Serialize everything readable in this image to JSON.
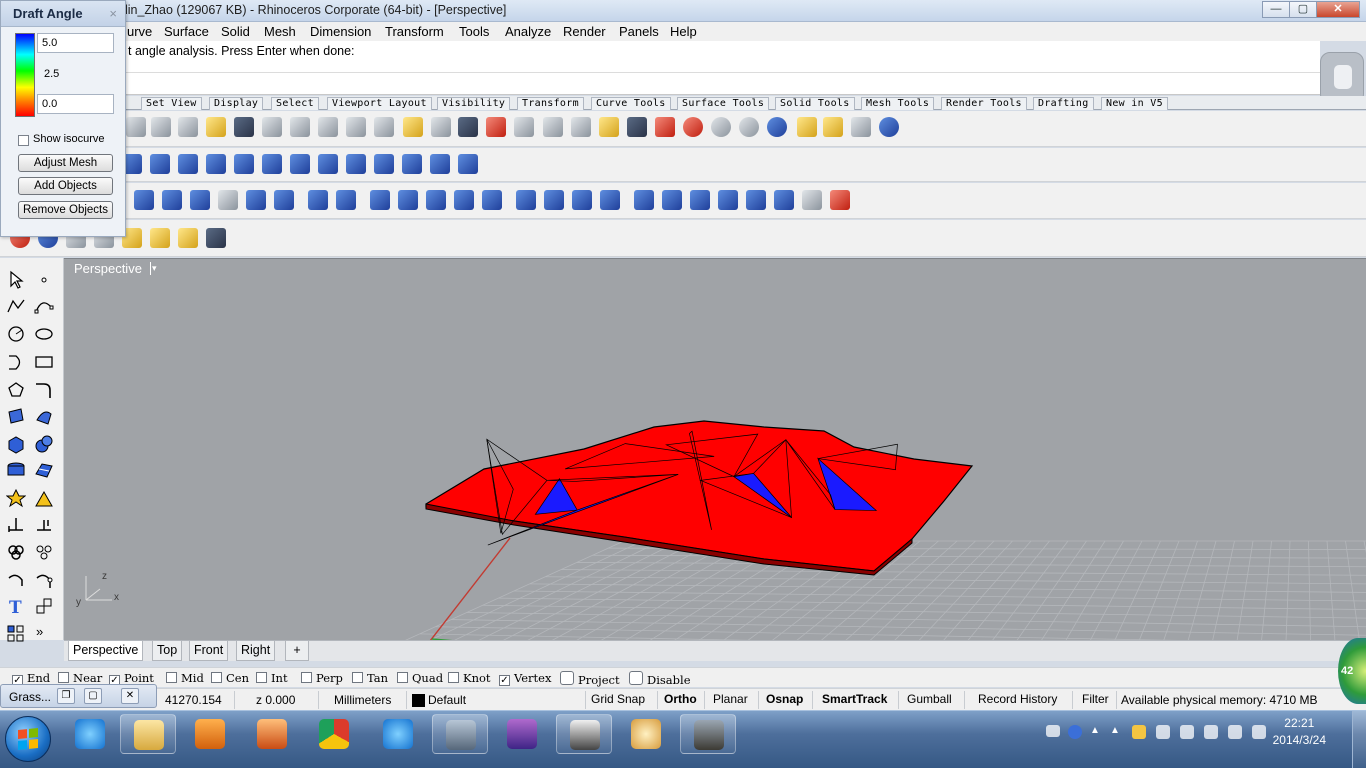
{
  "window": {
    "title": "glin_Zhao (129067 KB) - Rhinoceros Corporate (64-bit) - [Perspective]",
    "buttons": [
      "—",
      "▢",
      "✕"
    ]
  },
  "menu": [
    "urve",
    "Surface",
    "Solid",
    "Mesh",
    "Dimension",
    "Transform",
    "Tools",
    "Analyze",
    "Render",
    "Panels",
    "Help"
  ],
  "command": {
    "prompt": "t angle analysis. Press Enter when done:"
  },
  "toolbar_tabs": [
    "Set View",
    "Display",
    "Select",
    "Viewport Layout",
    "Visibility",
    "Transform",
    "Curve Tools",
    "Surface Tools",
    "Solid Tools",
    "Mesh Tools",
    "Render Tools",
    "Drafting",
    "New in V5"
  ],
  "draft_panel": {
    "title": "Draft Angle",
    "close": "×",
    "max_value": "5.0",
    "mid_value": "2.5",
    "min_value": "0.0",
    "show_isocurve": "Show isocurve",
    "adjust_mesh": "Adjust Mesh",
    "add_objects": "Add Objects",
    "remove_objects": "Remove Objects"
  },
  "viewport": {
    "label": "Perspective",
    "dropdown": "▾",
    "axis_x": "x",
    "axis_y": "y",
    "axis_z": "z"
  },
  "viewport_tabs": [
    "Perspective",
    "Top",
    "Front",
    "Right",
    "+"
  ],
  "osnap": [
    {
      "label": "End",
      "checked": true
    },
    {
      "label": "Near",
      "checked": false
    },
    {
      "label": "Point",
      "checked": true
    },
    {
      "label": "Mid",
      "checked": false
    },
    {
      "label": "Cen",
      "checked": false
    },
    {
      "label": "Int",
      "checked": false
    },
    {
      "label": "Perp",
      "checked": false
    },
    {
      "label": "Tan",
      "checked": false
    },
    {
      "label": "Quad",
      "checked": false
    },
    {
      "label": "Knot",
      "checked": false
    },
    {
      "label": "Vertex",
      "checked": true
    },
    {
      "label": "Project",
      "checked": false
    },
    {
      "label": "Disable",
      "checked": false
    }
  ],
  "status": {
    "grass_title": "Grass...",
    "coord": "41270.154",
    "z": "z 0.000",
    "units": "Millimeters",
    "layer": "Default",
    "grid_snap": "Grid Snap",
    "ortho": "Ortho",
    "planar": "Planar",
    "osnap": "Osnap",
    "smarttrack": "SmartTrack",
    "gumball": "Gumball",
    "record_history": "Record History",
    "filter": "Filter",
    "memory": "Available physical memory: 4710 MB"
  },
  "badge": "42",
  "taskbar": {
    "time": "22:21",
    "date": "2014/3/24"
  }
}
